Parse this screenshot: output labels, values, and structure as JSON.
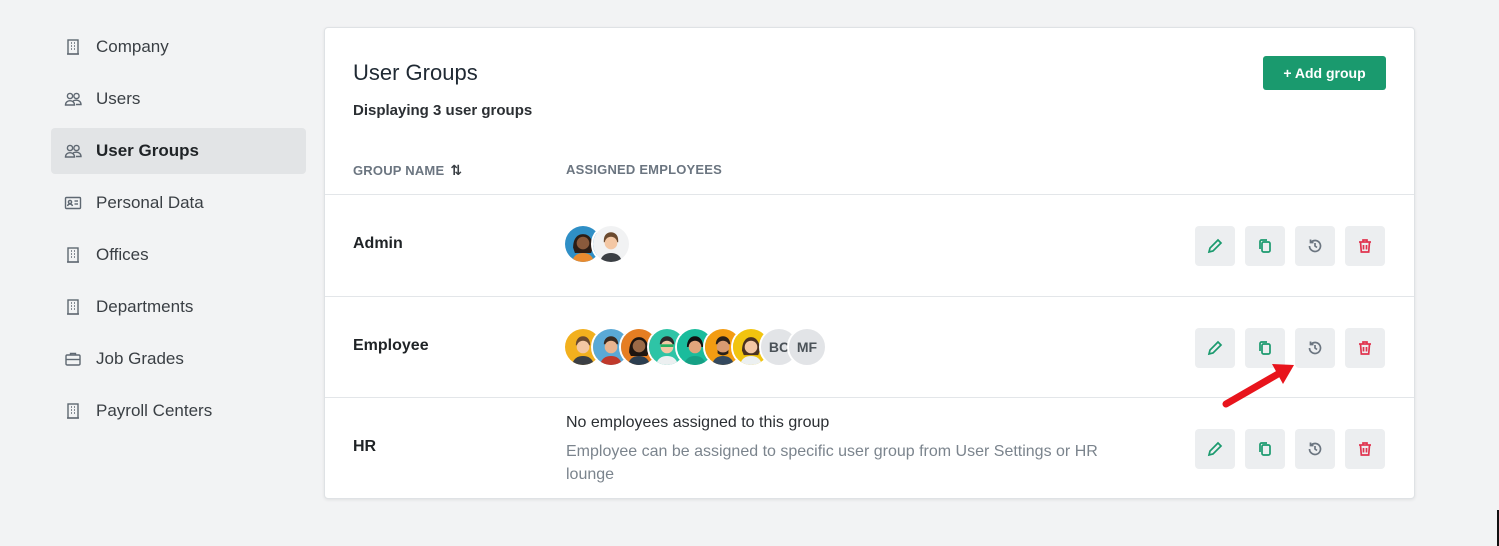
{
  "sidebar": {
    "items": [
      {
        "label": "Company",
        "icon": "building-icon"
      },
      {
        "label": "Users",
        "icon": "users-icon"
      },
      {
        "label": "User Groups",
        "icon": "users-icon",
        "active": true
      },
      {
        "label": "Personal Data",
        "icon": "id-card-icon"
      },
      {
        "label": "Offices",
        "icon": "building-icon"
      },
      {
        "label": "Departments",
        "icon": "building-icon"
      },
      {
        "label": "Job Grades",
        "icon": "briefcase-icon"
      },
      {
        "label": "Payroll Centers",
        "icon": "building-icon"
      }
    ]
  },
  "card": {
    "title": "User Groups",
    "subtitle": "Displaying 3 user groups",
    "add_button": "+ Add group",
    "columns": {
      "group_name": "GROUP NAME",
      "sort_icon": "sort-icon",
      "assigned": "ASSIGNED EMPLOYEES"
    }
  },
  "groups": [
    {
      "name": "Admin",
      "avatars": [
        "avatar-photo",
        "avatar-photo"
      ]
    },
    {
      "name": "Employee",
      "avatars": [
        "avatar-photo",
        "avatar-photo",
        "avatar-photo",
        "avatar-photo",
        "avatar-photo",
        "avatar-photo",
        "avatar-photo"
      ],
      "initials": [
        "BC",
        "MF"
      ]
    },
    {
      "name": "HR",
      "empty_title": "No employees assigned to this group",
      "empty_text": "Employee can be assigned to specific user group from User Settings or HR lounge"
    }
  ],
  "colors": {
    "accent": "#1a9a6e",
    "danger": "#e0344f",
    "arrow": "#e8141c"
  }
}
